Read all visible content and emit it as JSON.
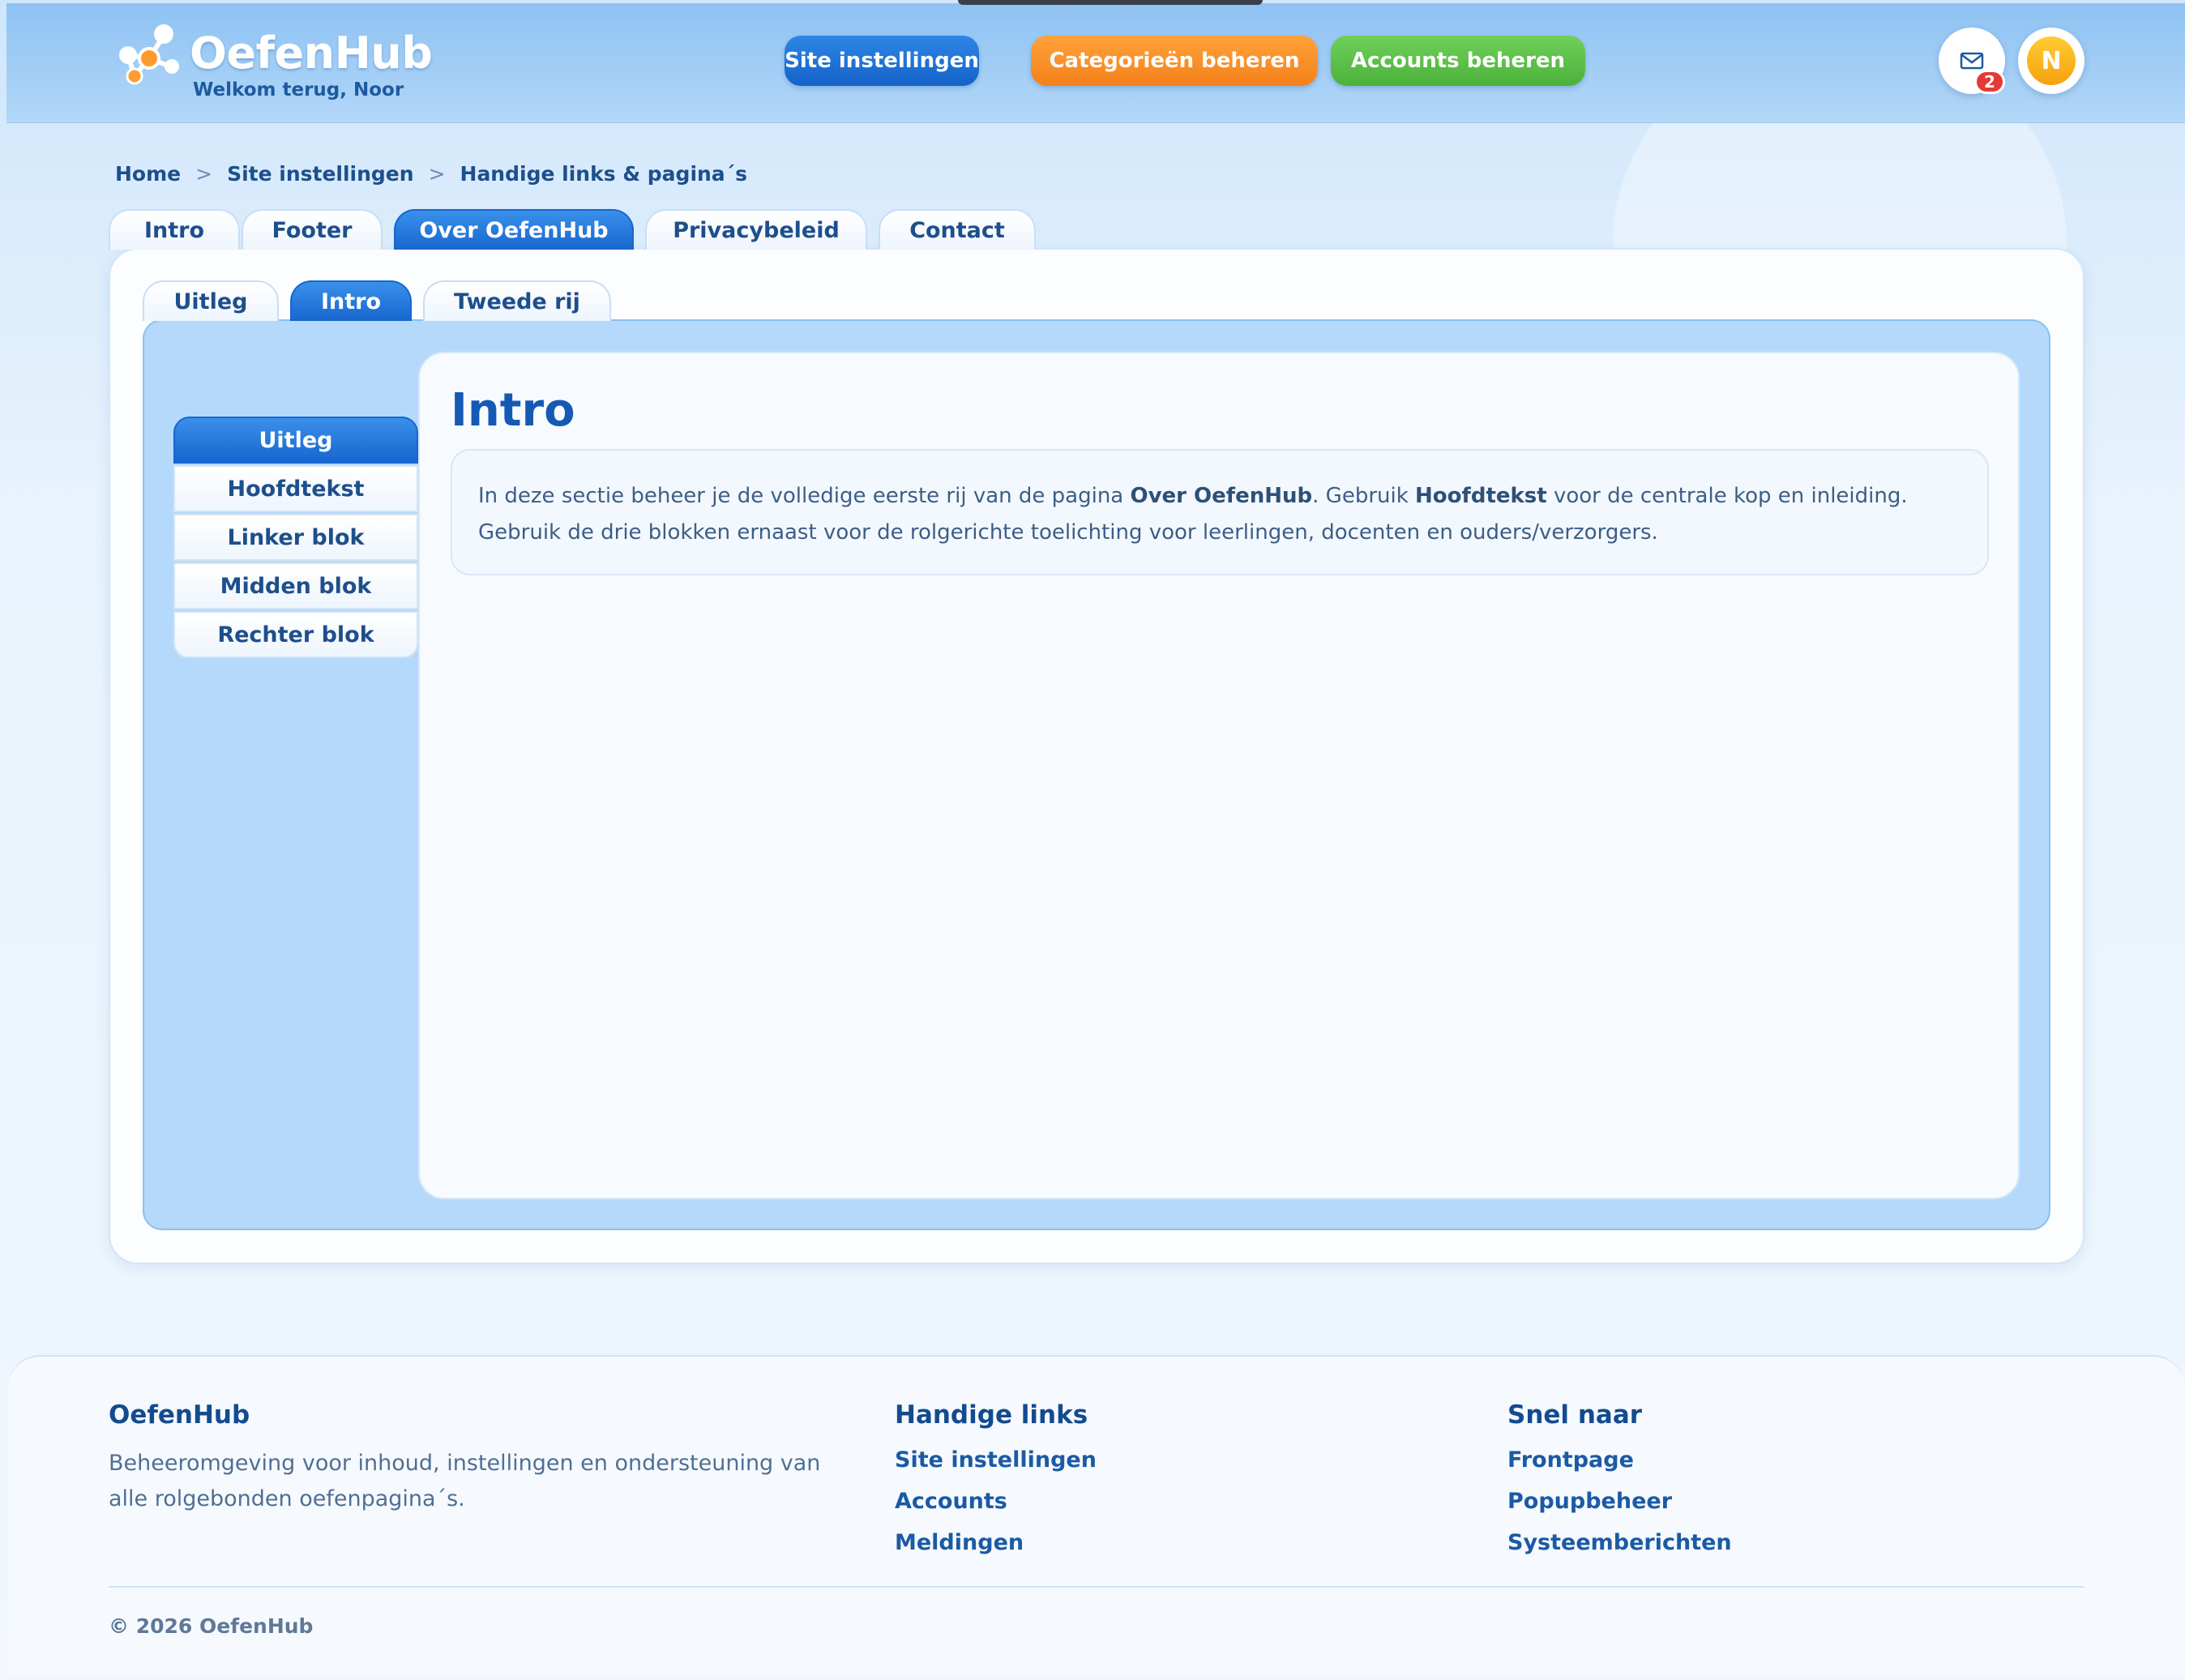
{
  "header": {
    "logo_text": "OefenHub",
    "welcome": "Welkom terug, Noor",
    "nav": {
      "site_settings": "Site instellingen",
      "categories": "Categorieën beheren",
      "accounts": "Accounts beheren"
    },
    "mail_badge_count": "2",
    "avatar_initial": "N"
  },
  "breadcrumb": {
    "items": [
      "Home",
      "Site instellingen",
      "Handige links & pagina´s"
    ],
    "separator": ">"
  },
  "top_tabs": [
    "Intro",
    "Footer",
    "Over OefenHub",
    "Privacybeleid",
    "Contact"
  ],
  "top_tabs_active": "Over OefenHub",
  "sub_tabs": [
    "Uitleg",
    "Intro",
    "Tweede rij"
  ],
  "sub_tabs_active": "Intro",
  "side_menu": [
    "Uitleg",
    "Hoofdtekst",
    "Linker blok",
    "Midden blok",
    "Rechter blok"
  ],
  "side_menu_active": "Uitleg",
  "content": {
    "title": "Intro",
    "text_1": "In deze sectie beheer je de volledige eerste rij van de pagina ",
    "bold_1": "Over OefenHub",
    "text_2": ". Gebruik ",
    "bold_2": "Hoofdtekst",
    "text_3": " voor de centrale kop en inleiding. Gebruik de drie blokken ernaast voor de rolgerichte toelichting voor leerlingen, docenten en ouders/verzorgers."
  },
  "footer": {
    "brand_title": "OefenHub",
    "brand_text": "Beheeromgeving voor inhoud, instellingen en ondersteuning van alle rolgebonden oefenpagina´s.",
    "links_title": "Handige links",
    "links": [
      "Site instellingen",
      "Accounts",
      "Meldingen"
    ],
    "quick_title": "Snel naar",
    "quick": [
      "Frontpage",
      "Popupbeheer",
      "Systeemberichten"
    ],
    "copyright": "© 2026 OefenHub"
  },
  "colors": {
    "primary": "#1766cf",
    "orange": "#f4801a",
    "green": "#4cb13a",
    "badge": "#e53935",
    "panel_blue": "#b4d9fb"
  }
}
